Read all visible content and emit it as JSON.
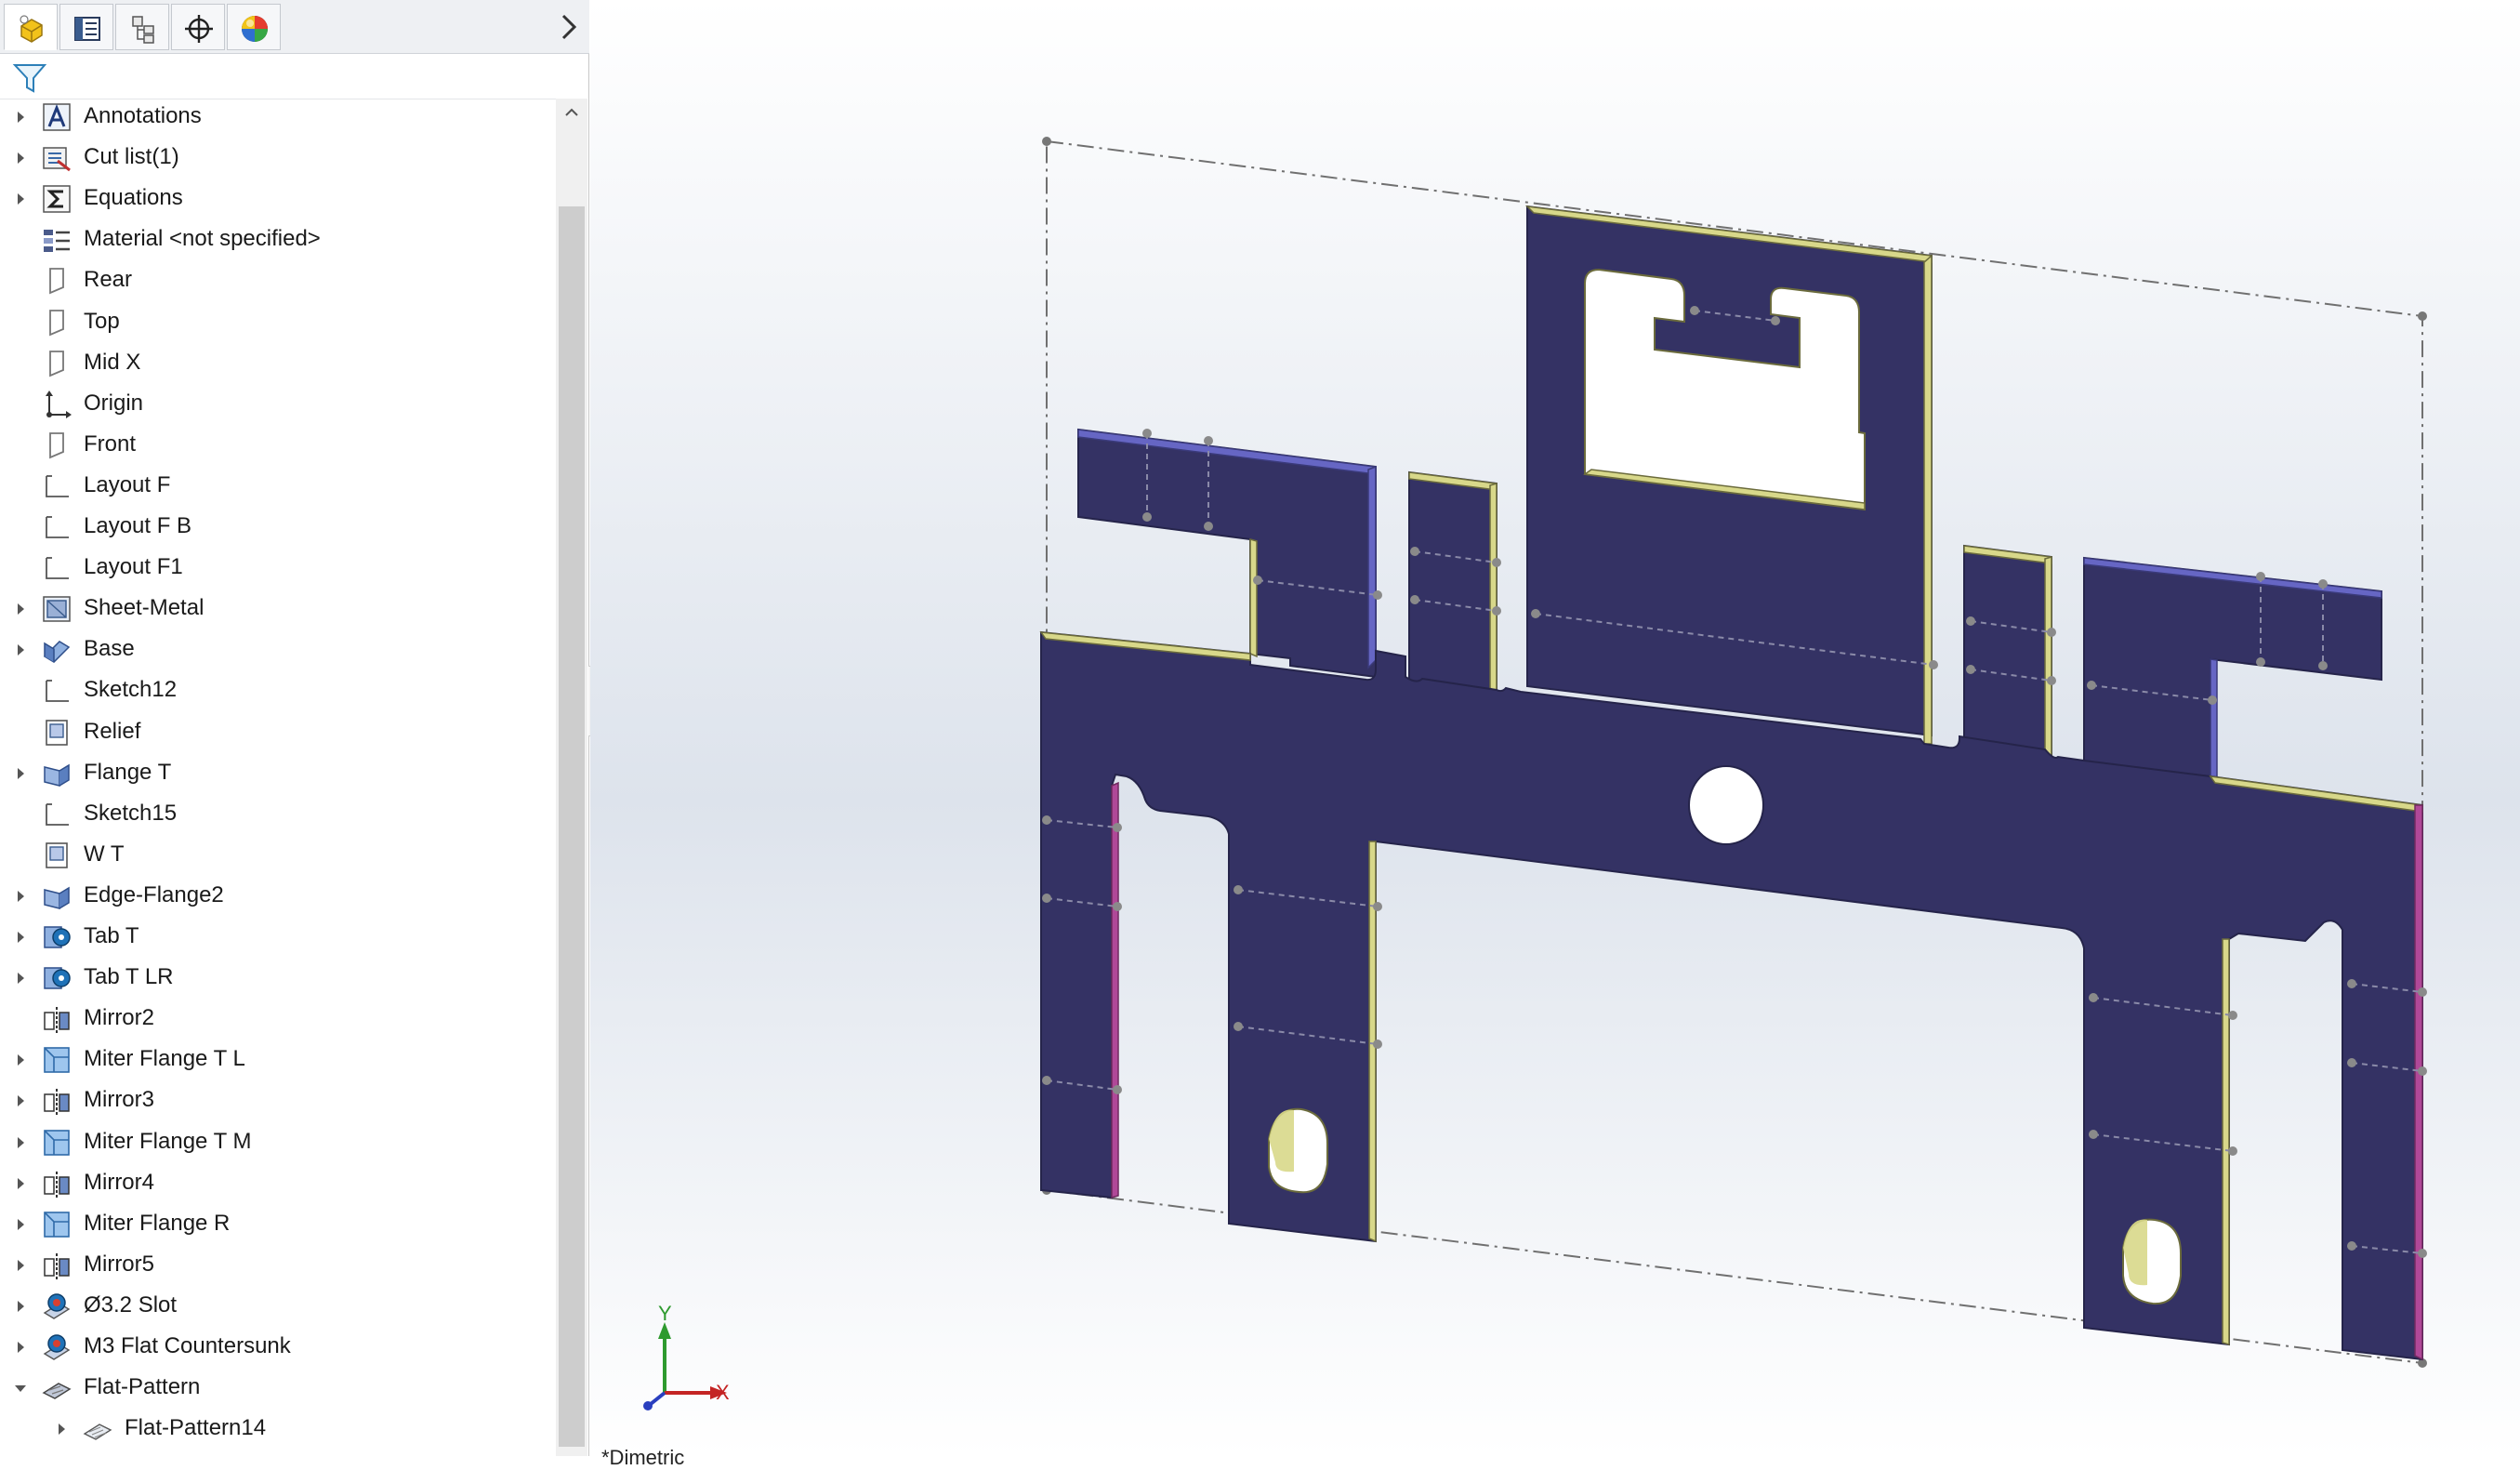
{
  "panel": {
    "tabs": [
      {
        "name": "feature-manager-tab",
        "icon": "feature-manager-icon"
      },
      {
        "name": "property-manager-tab",
        "icon": "property-manager-icon"
      },
      {
        "name": "configuration-manager-tab",
        "icon": "configuration-manager-icon"
      },
      {
        "name": "dimxpert-manager-tab",
        "icon": "crosshair-icon"
      },
      {
        "name": "display-manager-tab",
        "icon": "appearance-sphere-icon"
      }
    ],
    "filter_icon": "filter-icon"
  },
  "tree": {
    "items": [
      {
        "label": "Annotations",
        "icon": "annotations-icon",
        "expandable": true
      },
      {
        "label": "Cut list(1)",
        "icon": "cut-list-icon",
        "expandable": true
      },
      {
        "label": "Equations",
        "icon": "equations-icon",
        "expandable": true
      },
      {
        "label": "Material <not specified>",
        "icon": "material-icon",
        "expandable": false
      },
      {
        "label": "Rear",
        "icon": "plane-icon",
        "expandable": false
      },
      {
        "label": "Top",
        "icon": "plane-icon",
        "expandable": false
      },
      {
        "label": "Mid X",
        "icon": "plane-icon",
        "expandable": false
      },
      {
        "label": "Origin",
        "icon": "origin-icon",
        "expandable": false
      },
      {
        "label": "Front",
        "icon": "plane-icon",
        "expandable": false
      },
      {
        "label": "Layout F",
        "icon": "sketch-icon",
        "expandable": false
      },
      {
        "label": "Layout F B",
        "icon": "sketch-icon",
        "expandable": false
      },
      {
        "label": "Layout F1",
        "icon": "sketch-icon",
        "expandable": false
      },
      {
        "label": "Sheet-Metal",
        "icon": "sheet-metal-icon",
        "expandable": true
      },
      {
        "label": "Base",
        "icon": "base-flange-icon",
        "expandable": true
      },
      {
        "label": "Sketch12",
        "icon": "sketch-icon",
        "expandable": false
      },
      {
        "label": "Relief",
        "icon": "relief-icon",
        "expandable": false
      },
      {
        "label": "Flange T",
        "icon": "flange-icon",
        "expandable": true
      },
      {
        "label": "Sketch15",
        "icon": "sketch-icon",
        "expandable": false
      },
      {
        "label": "W T",
        "icon": "relief-icon",
        "expandable": false
      },
      {
        "label": "Edge-Flange2",
        "icon": "flange-icon",
        "expandable": true
      },
      {
        "label": "Tab T",
        "icon": "tab-icon",
        "expandable": true
      },
      {
        "label": "Tab T LR",
        "icon": "tab-icon",
        "expandable": true
      },
      {
        "label": "Mirror2",
        "icon": "mirror-icon",
        "expandable": false
      },
      {
        "label": "Miter Flange T L",
        "icon": "miter-flange-icon",
        "expandable": true
      },
      {
        "label": "Mirror3",
        "icon": "mirror-icon",
        "expandable": true
      },
      {
        "label": "Miter Flange T M",
        "icon": "miter-flange-icon",
        "expandable": true
      },
      {
        "label": "Mirror4",
        "icon": "mirror-icon",
        "expandable": true
      },
      {
        "label": "Miter Flange R",
        "icon": "miter-flange-icon",
        "expandable": true
      },
      {
        "label": "Mirror5",
        "icon": "mirror-icon",
        "expandable": true
      },
      {
        "label": "Ø3.2 Slot",
        "icon": "hole-wizard-icon",
        "expandable": true
      },
      {
        "label": "M3 Flat Countersunk",
        "icon": "hole-wizard-icon",
        "expandable": true
      },
      {
        "label": "Flat-Pattern",
        "icon": "flat-pattern-icon",
        "expandable": true,
        "expanded": true
      },
      {
        "label": "Flat-Pattern14",
        "icon": "flat-pattern-child-icon",
        "expandable": true,
        "indent": 1
      }
    ]
  },
  "viewport": {
    "triad": {
      "x_label": "X",
      "y_label": "Y"
    },
    "bottom_text": "*Dimetric",
    "colors": {
      "face": "#343264",
      "edge_yellow": "#d8d88a",
      "edge_blue": "#6868c8",
      "edge_pink": "#b04898"
    }
  }
}
